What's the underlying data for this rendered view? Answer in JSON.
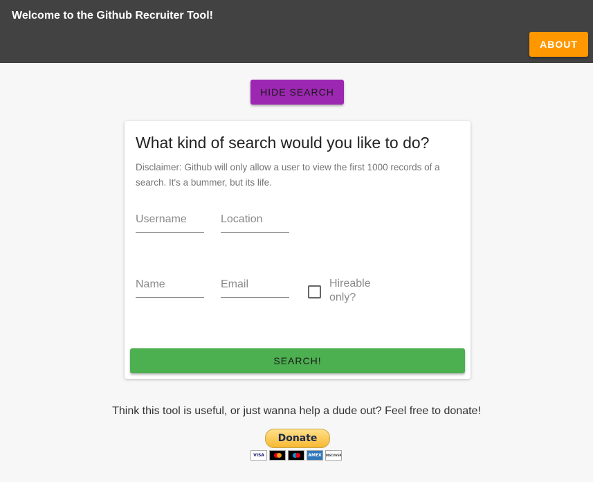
{
  "appbar": {
    "title": "Welcome to the Github Recruiter Tool!",
    "about_label": "About"
  },
  "hide_search_label": "Hide Search",
  "search_card": {
    "heading": "What kind of search would you like to do?",
    "disclaimer": "Disclaimer: Github will only allow a user to view the first 1000 records of a search. It's a bummer, but its life.",
    "fields": {
      "username_placeholder": "Username",
      "location_placeholder": "Location",
      "name_placeholder": "Name",
      "email_placeholder": "Email"
    },
    "hireable_label": "Hireable only?",
    "hireable_checked": false,
    "search_label": "Search!"
  },
  "donate": {
    "text": "Think this tool is useful, or just wanna help a dude out? Feel free to donate!",
    "button_label": "Donate",
    "cards": [
      "VISA",
      "mastercard-icon",
      "maestro-icon",
      "AMEX",
      "DISCOVER"
    ]
  },
  "colors": {
    "appbar": "#424242",
    "about": "#ff9800",
    "hide_search": "#9c27b0",
    "search": "#4caf50"
  }
}
